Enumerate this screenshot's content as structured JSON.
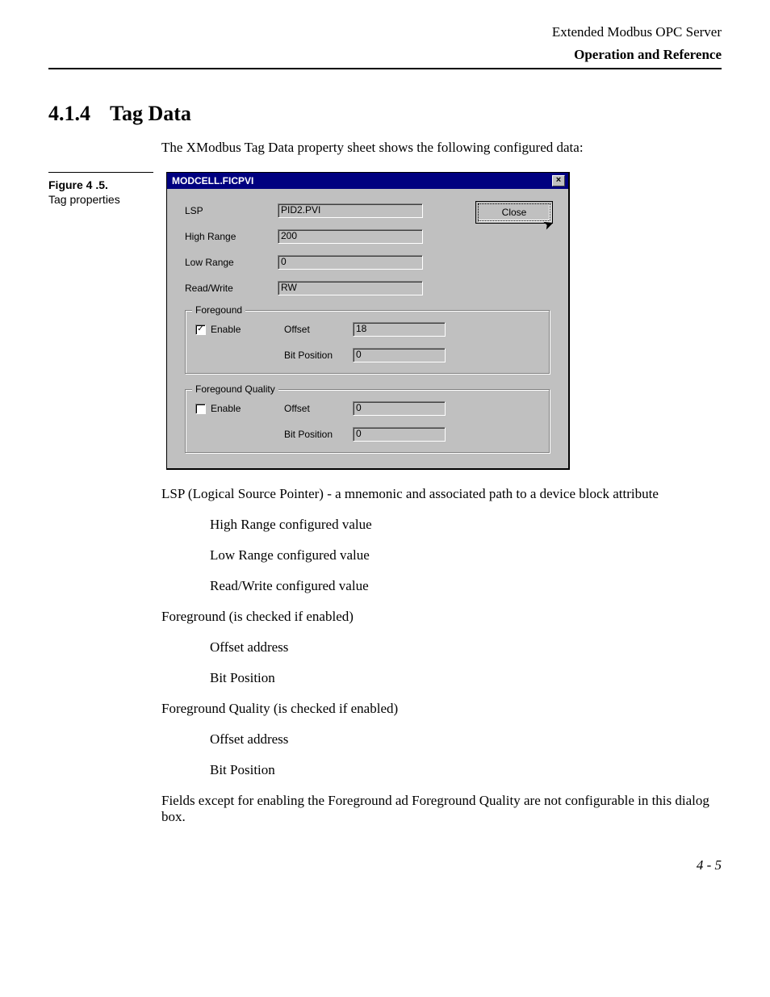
{
  "header": {
    "product": "Extended Modbus OPC Server",
    "section": "Operation and Reference"
  },
  "heading": {
    "number": "4.1.4",
    "title": "Tag Data"
  },
  "intro": "The XModbus Tag Data property sheet shows the following configured data:",
  "figure": {
    "title": "Figure 4 .5.",
    "caption": "Tag properties"
  },
  "dialog": {
    "title": "MODCELL.FICPVI",
    "close_x": "×",
    "close_button": "Close",
    "fields": {
      "lsp_label": "LSP",
      "lsp_value": "PID2.PVI",
      "high_range_label": "High Range",
      "high_range_value": "200",
      "low_range_label": "Low Range",
      "low_range_value": "0",
      "read_write_label": "Read/Write",
      "read_write_value": "RW"
    },
    "foreground": {
      "legend": "Foregound",
      "enable_label": "Enable",
      "enable_checked": "✓",
      "offset_label": "Offset",
      "offset_value": "18",
      "bitpos_label": "Bit Position",
      "bitpos_value": "0"
    },
    "foreground_quality": {
      "legend": "Foregound Quality",
      "enable_label": "Enable",
      "enable_checked": "",
      "offset_label": "Offset",
      "offset_value": "0",
      "bitpos_label": "Bit Position",
      "bitpos_value": "0"
    }
  },
  "explanation": {
    "lsp_line": "LSP (Logical Source Pointer) - a mnemonic and associated path to a device block attribute",
    "high_range": "High Range configured value",
    "low_range": "Low Range configured value",
    "read_write": "Read/Write configured value",
    "fg_heading": "Foreground (is checked if enabled)",
    "fg_offset": "Offset address",
    "fg_bitpos": "Bit Position",
    "fgq_heading": "Foreground Quality (is checked if enabled)",
    "fgq_offset": "Offset address",
    "fgq_bitpos": "Bit Position",
    "footnote": "Fields except for enabling the Foreground ad Foreground Quality are not configurable in this dialog box."
  },
  "page_number": "4 - 5"
}
